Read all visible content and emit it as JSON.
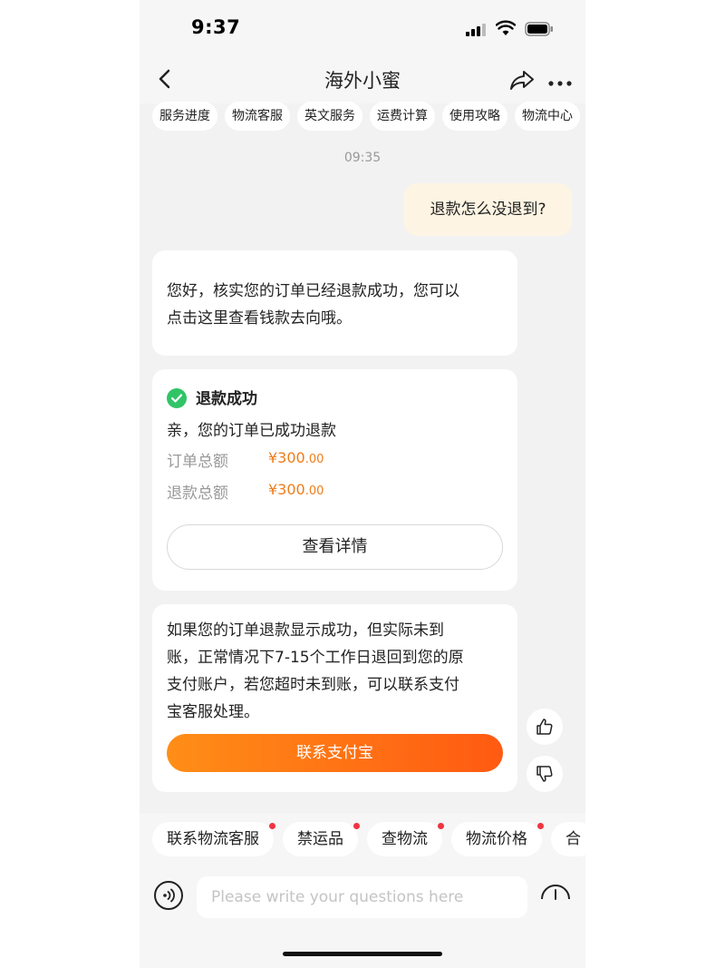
{
  "status_bar": {
    "time": "9:37"
  },
  "nav": {
    "title": "海外小蜜"
  },
  "top_chips": [
    "服务进度",
    "物流客服",
    "英文服务",
    "运费计算",
    "使用攻略",
    "物流中心"
  ],
  "chat": {
    "timestamp": "09:35",
    "user_message": "退款怎么没退到?",
    "bot_message_1_line1": "您好，核实您的订单已经退款成功，您可以",
    "bot_message_1_line2": "点击这里查看钱款去向哦。",
    "refund_card": {
      "title": "退款成功",
      "subtitle": "亲，您的订单已成功退款",
      "order_total_label": "订单总额",
      "order_total_value": "¥300",
      "order_total_cents": ".00",
      "refund_total_label": "退款总额",
      "refund_total_value": "¥300",
      "refund_total_cents": ".00",
      "detail_button": "查看详情"
    },
    "bot_message_2_lines": [
      "如果您的订单退款显示成功，但实际未到",
      "账，正常情况下7-15个工作日退回到您的原",
      "支付账户，若您超时未到账，可以联系支付",
      "宝客服处理。"
    ],
    "contact_button": "联系支付宝"
  },
  "quick_replies": [
    "联系物流客服",
    "禁运品",
    "查物流",
    "物流价格",
    "合"
  ],
  "input": {
    "placeholder": "Please write your questions here"
  },
  "colors": {
    "accent_orange": "#ff6a14",
    "success_green": "#31c467",
    "price_orange": "#ee7d1a",
    "user_bubble": "#fdf4e3"
  }
}
